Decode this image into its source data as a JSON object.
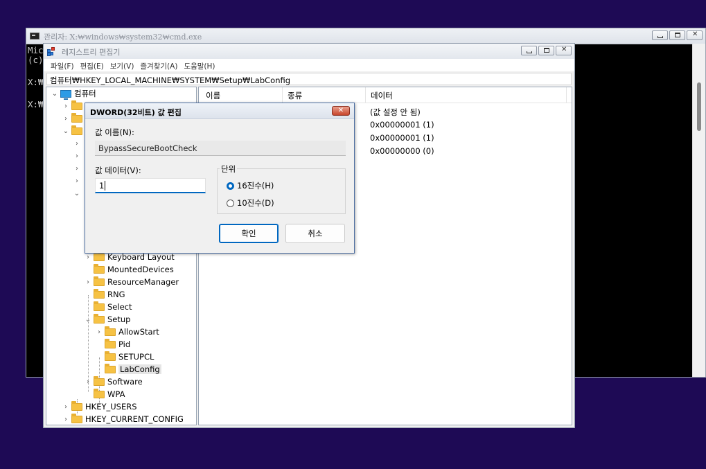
{
  "cmd": {
    "title": "관리자: X:₩windows₩system32₩cmd.exe",
    "lines": [
      "Mic",
      "(c)",
      "",
      "X:₩",
      "",
      "X:₩"
    ]
  },
  "regedit": {
    "title": "레지스트리 편집기",
    "menu": [
      "파일(F)",
      "편집(E)",
      "보기(V)",
      "즐겨찾기(A)",
      "도움말(H)"
    ],
    "address": "컴퓨터₩HKEY_LOCAL_MACHINE₩SYSTEM₩Setup₩LabConfig",
    "tree": {
      "root": "컴퓨터",
      "visible_nodes": [
        "Keyboard Layout",
        "MountedDevices",
        "ResourceManager",
        "RNG",
        "Select",
        "Setup",
        "AllowStart",
        "Pid",
        "SETUPCL",
        "LabConfig",
        "Software",
        "WPA",
        "HKEY_USERS",
        "HKEY_CURRENT_CONFIG"
      ]
    },
    "list": {
      "columns": [
        "이름",
        "종류",
        "데이터"
      ],
      "data_values": [
        "(값 설정 안 됨)",
        "0x00000001 (1)",
        "0x00000001 (1)",
        "0x00000000 (0)"
      ]
    }
  },
  "dialog": {
    "title": "DWORD(32비트) 값 편집",
    "close_label": "✕",
    "name_label": "값 이름(N):",
    "name_value": "BypassSecureBootCheck",
    "data_label": "값 데이터(V):",
    "data_value": "1",
    "base_label": "단위",
    "hex_label": "16진수(H)",
    "dec_label": "10진수(D)",
    "ok_label": "확인",
    "cancel_label": "취소"
  }
}
